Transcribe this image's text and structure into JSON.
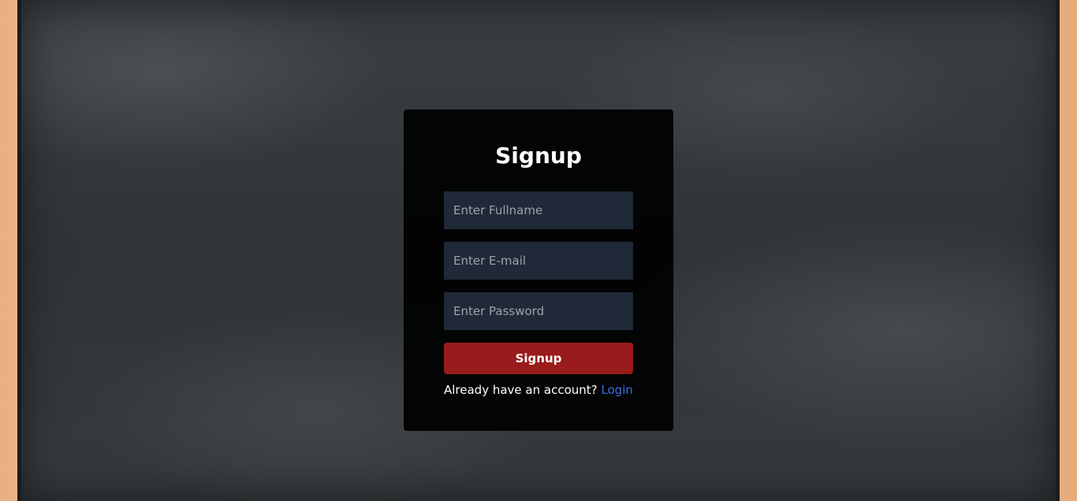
{
  "form": {
    "title": "Signup",
    "fullname_placeholder": "Enter Fullname",
    "email_placeholder": "Enter E-mail",
    "password_placeholder": "Enter Password",
    "fullname_value": "",
    "email_value": "",
    "password_value": "",
    "submit_label": "Signup",
    "login_prompt": "Already have an account?",
    "login_link": "Login"
  },
  "colors": {
    "card_background": "#000000",
    "input_background": "#1f2937",
    "button_background": "#991b1b",
    "link": "#3b6fe0",
    "board": "#33383b",
    "frame_wood": "#f3c9a0"
  }
}
